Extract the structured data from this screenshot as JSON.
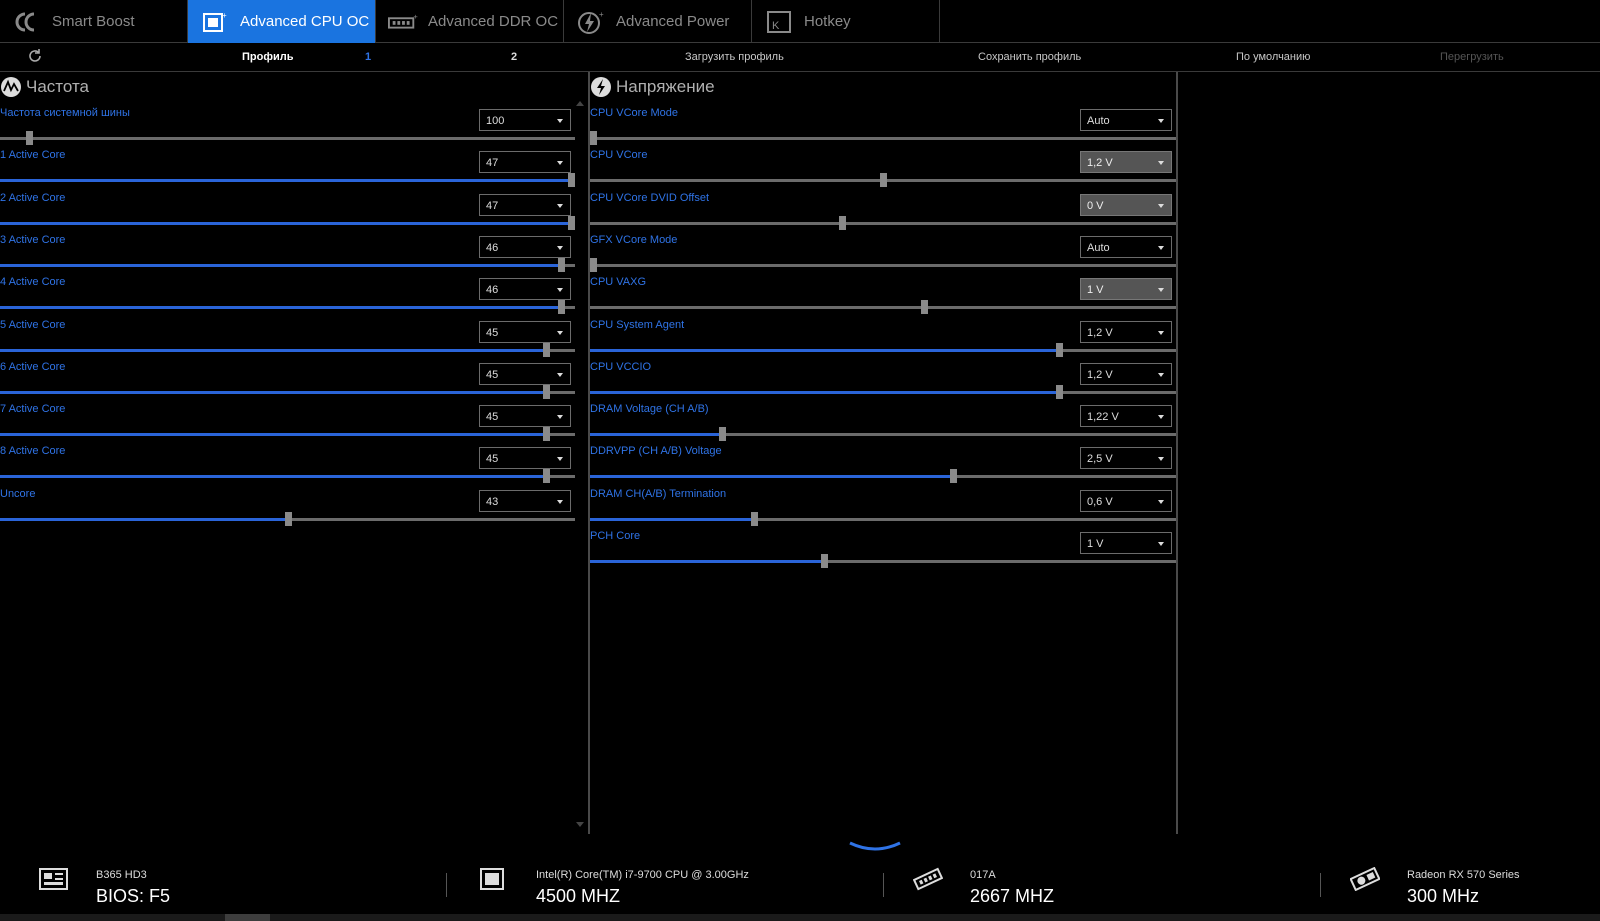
{
  "tabs": [
    {
      "label": "Smart Boost",
      "icon": "smart-boost-icon",
      "active": false
    },
    {
      "label": "Advanced CPU OC",
      "icon": "cpu-icon",
      "active": true
    },
    {
      "label": "Advanced DDR OC",
      "icon": "ram-icon",
      "active": false
    },
    {
      "label": "Advanced Power",
      "icon": "power-bolt-icon",
      "active": false
    },
    {
      "label": "Hotkey",
      "icon": "hotkey-icon",
      "active": false
    }
  ],
  "toolbar": {
    "profile_label": "Профиль",
    "profile_1": "1",
    "profile_2": "2",
    "load_profile": "Загрузить профиль",
    "save_profile": "Сохранить профиль",
    "default": "По умолчанию",
    "reboot": "Перегрузить"
  },
  "frequency": {
    "title": "Частота",
    "rows": [
      {
        "label": "Частота системной шины",
        "value": "100",
        "slider": 0.05,
        "filled": false
      },
      {
        "label": "1 Active Core",
        "value": "47",
        "slider": 1.0,
        "filled": true
      },
      {
        "label": "2 Active Core",
        "value": "47",
        "slider": 1.0,
        "filled": true
      },
      {
        "label": "3 Active Core",
        "value": "46",
        "slider": 0.975,
        "filled": true
      },
      {
        "label": "4 Active Core",
        "value": "46",
        "slider": 0.975,
        "filled": true
      },
      {
        "label": "5 Active Core",
        "value": "45",
        "slider": 0.95,
        "filled": true
      },
      {
        "label": "6 Active Core",
        "value": "45",
        "slider": 0.95,
        "filled": true
      },
      {
        "label": "7 Active Core",
        "value": "45",
        "slider": 0.95,
        "filled": true
      },
      {
        "label": "8 Active Core",
        "value": "45",
        "slider": 0.95,
        "filled": true
      },
      {
        "label": "Uncore",
        "value": "43",
        "slider": 0.5,
        "filled": true
      }
    ]
  },
  "voltage": {
    "title": "Напряжение",
    "rows": [
      {
        "label": "CPU VCore Mode",
        "value": "Auto",
        "slider": 0.0,
        "filled": false,
        "disabled": false
      },
      {
        "label": "CPU VCore",
        "value": "1,2 V",
        "slider": 0.5,
        "filled": false,
        "disabled": true
      },
      {
        "label": "CPU VCore DVID Offset",
        "value": "0 V",
        "slider": 0.43,
        "filled": false,
        "disabled": true
      },
      {
        "label": "GFX VCore Mode",
        "value": "Auto",
        "slider": 0.0,
        "filled": false,
        "disabled": false
      },
      {
        "label": "CPU VAXG",
        "value": "1 V",
        "slider": 0.57,
        "filled": false,
        "disabled": true
      },
      {
        "label": "CPU System Agent",
        "value": "1,2 V",
        "slider": 0.8,
        "filled": true,
        "disabled": false
      },
      {
        "label": "CPU VCCIO",
        "value": "1,2 V",
        "slider": 0.8,
        "filled": true,
        "disabled": false
      },
      {
        "label": "DRAM Voltage (CH A/B)",
        "value": "1,22 V",
        "slider": 0.225,
        "filled": true,
        "disabled": false
      },
      {
        "label": "DDRVPP (CH A/B) Voltage",
        "value": "2,5 V",
        "slider": 0.62,
        "filled": true,
        "disabled": false
      },
      {
        "label": "DRAM CH(A/B) Termination",
        "value": "0,6 V",
        "slider": 0.28,
        "filled": true,
        "disabled": false
      },
      {
        "label": "PCH Core",
        "value": "1 V",
        "slider": 0.4,
        "filled": true,
        "disabled": false
      }
    ]
  },
  "footer": [
    {
      "icon": "motherboard-icon",
      "small": "B365 HD3",
      "big": "BIOS: F5"
    },
    {
      "icon": "cpu-chip-icon",
      "small": "Intel(R) Core(TM) i7-9700 CPU @ 3.00GHz",
      "big": "4500 MHZ"
    },
    {
      "icon": "memory-icon",
      "small": "017A",
      "big": "2667 MHZ"
    },
    {
      "icon": "gpu-icon",
      "small": "Radeon RX 570 Series",
      "big": "300 MHz"
    }
  ],
  "colors": {
    "accent": "#1a74e0",
    "label_blue": "#2f73e6",
    "slider_fill": "#2a64d8"
  }
}
